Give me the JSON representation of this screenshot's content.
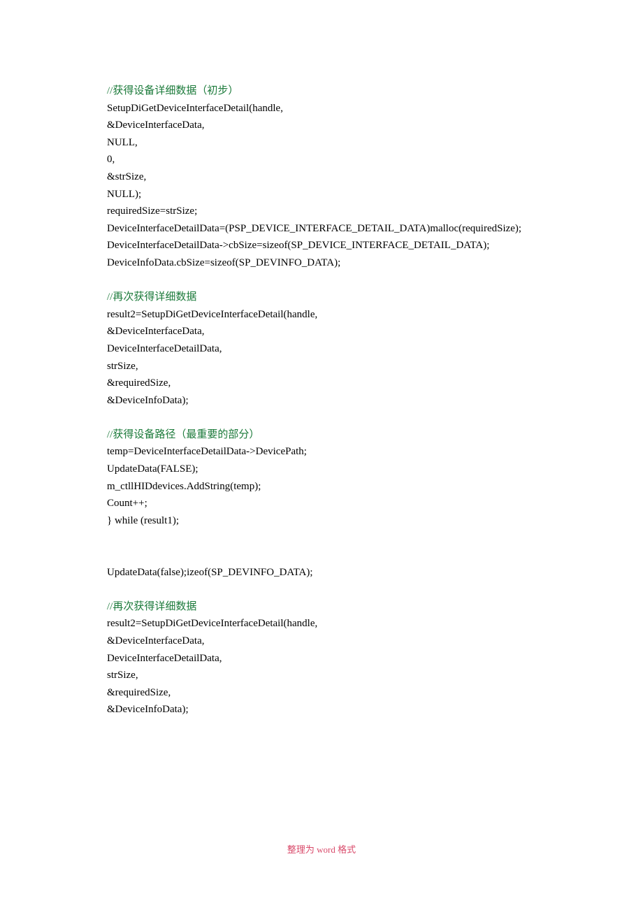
{
  "lines": [
    {
      "text": "//获得设备详细数据（初步）",
      "comment": true
    },
    {
      "text": "SetupDiGetDeviceInterfaceDetail(handle,"
    },
    {
      "text": "&DeviceInterfaceData,"
    },
    {
      "text": "NULL,"
    },
    {
      "text": "0,"
    },
    {
      "text": "&strSize,"
    },
    {
      "text": "NULL);"
    },
    {
      "text": "requiredSize=strSize;"
    },
    {
      "text": "DeviceInterfaceDetailData=(PSP_DEVICE_INTERFACE_DETAIL_DATA)malloc(requiredSize);"
    },
    {
      "text": "DeviceInterfaceDetailData->cbSize=sizeof(SP_DEVICE_INTERFACE_DETAIL_DATA);"
    },
    {
      "text": "DeviceInfoData.cbSize=sizeof(SP_DEVINFO_DATA);"
    },
    {
      "spacer": true
    },
    {
      "text": "//再次获得详细数据",
      "comment": true
    },
    {
      "text": "result2=SetupDiGetDeviceInterfaceDetail(handle,"
    },
    {
      "text": "&DeviceInterfaceData,"
    },
    {
      "text": "DeviceInterfaceDetailData,"
    },
    {
      "text": "strSize,"
    },
    {
      "text": "&requiredSize,"
    },
    {
      "text": "&DeviceInfoData);"
    },
    {
      "spacer": true
    },
    {
      "text": "//获得设备路径（最重要的部分）",
      "comment": true
    },
    {
      "text": "temp=DeviceInterfaceDetailData->DevicePath;"
    },
    {
      "text": "UpdateData(FALSE);"
    },
    {
      "text": "m_ctllHIDdevices.AddString(temp);"
    },
    {
      "text": "Count++;"
    },
    {
      "text": "} while (result1);"
    },
    {
      "spacer": true
    },
    {
      "spacer": true
    },
    {
      "text": "UpdateData(false);izeof(SP_DEVINFO_DATA);"
    },
    {
      "spacer": true
    },
    {
      "text": "//再次获得详细数据",
      "comment": true
    },
    {
      "text": "result2=SetupDiGetDeviceInterfaceDetail(handle,"
    },
    {
      "text": "&DeviceInterfaceData,"
    },
    {
      "text": "DeviceInterfaceDetailData,"
    },
    {
      "text": "strSize,"
    },
    {
      "text": "&requiredSize,"
    },
    {
      "text": "&DeviceInfoData);"
    }
  ],
  "footer": {
    "prefix": "整理为",
    "word": " word ",
    "suffix": "格式"
  }
}
